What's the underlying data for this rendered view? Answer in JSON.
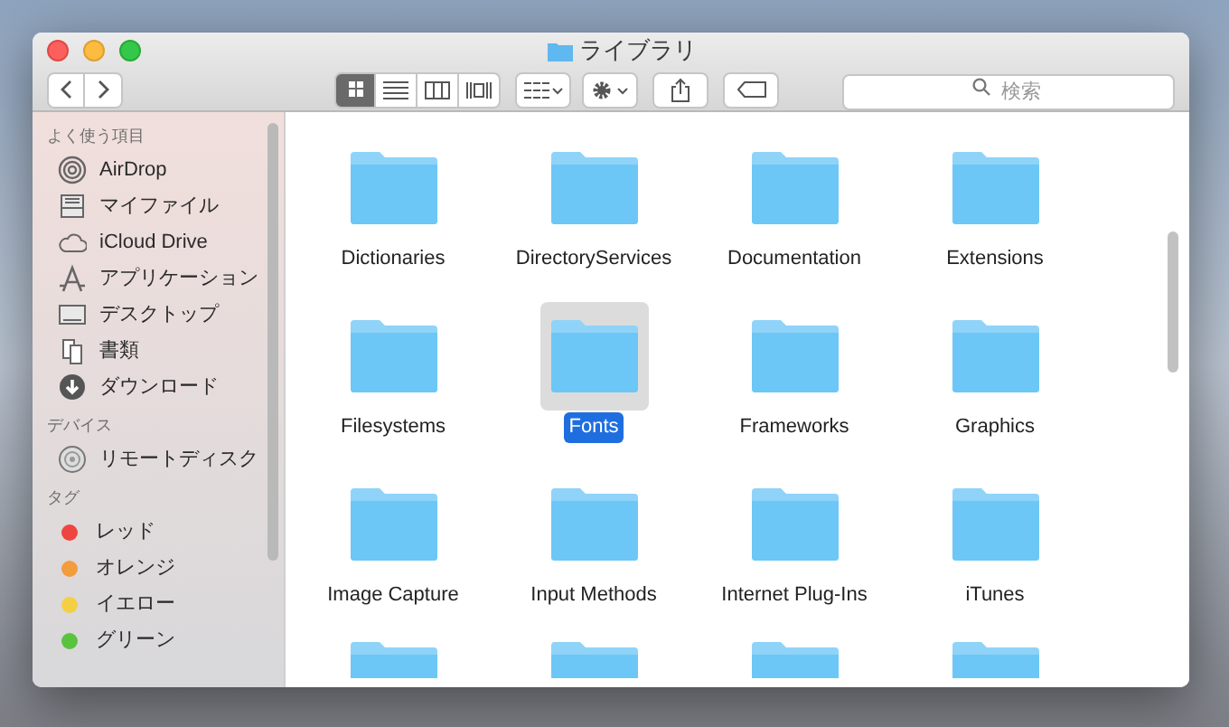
{
  "window": {
    "title": "ライブラリ"
  },
  "toolbar": {
    "view_buttons": [
      {
        "kind": "icon",
        "selected": true
      },
      {
        "kind": "list",
        "selected": false
      },
      {
        "kind": "columns",
        "selected": false
      },
      {
        "kind": "coverflow",
        "selected": false
      }
    ],
    "search": {
      "placeholder": "検索"
    }
  },
  "sidebar": {
    "sections": [
      {
        "title": "よく使う項目",
        "items": [
          {
            "kind": "airdrop",
            "label": "AirDrop"
          },
          {
            "kind": "myfiles",
            "label": "マイファイル"
          },
          {
            "kind": "cloud",
            "label": "iCloud Drive"
          },
          {
            "kind": "apps",
            "label": "アプリケーション"
          },
          {
            "kind": "desktop",
            "label": "デスクトップ"
          },
          {
            "kind": "documents",
            "label": "書類"
          },
          {
            "kind": "download",
            "label": "ダウンロード"
          }
        ]
      },
      {
        "title": "デバイス",
        "items": [
          {
            "kind": "disc",
            "label": "リモートディスク"
          }
        ]
      },
      {
        "title": "タグ",
        "items": [
          {
            "kind": "tag",
            "label": "レッド",
            "color": "#ee4540"
          },
          {
            "kind": "tag",
            "label": "オレンジ",
            "color": "#f39c3c"
          },
          {
            "kind": "tag",
            "label": "イエロー",
            "color": "#f5cf43"
          },
          {
            "kind": "tag",
            "label": "グリーン",
            "color": "#5ac33d"
          }
        ]
      }
    ]
  },
  "folders": [
    {
      "name": "Dictionaries",
      "selected": false
    },
    {
      "name": "DirectoryServices",
      "selected": false
    },
    {
      "name": "Documentation",
      "selected": false
    },
    {
      "name": "Extensions",
      "selected": false
    },
    {
      "name": "Filesystems",
      "selected": false
    },
    {
      "name": "Fonts",
      "selected": true
    },
    {
      "name": "Frameworks",
      "selected": false
    },
    {
      "name": "Graphics",
      "selected": false
    },
    {
      "name": "Image Capture",
      "selected": false
    },
    {
      "name": "Input Methods",
      "selected": false
    },
    {
      "name": "Internet Plug-Ins",
      "selected": false
    },
    {
      "name": "iTunes",
      "selected": false
    }
  ]
}
